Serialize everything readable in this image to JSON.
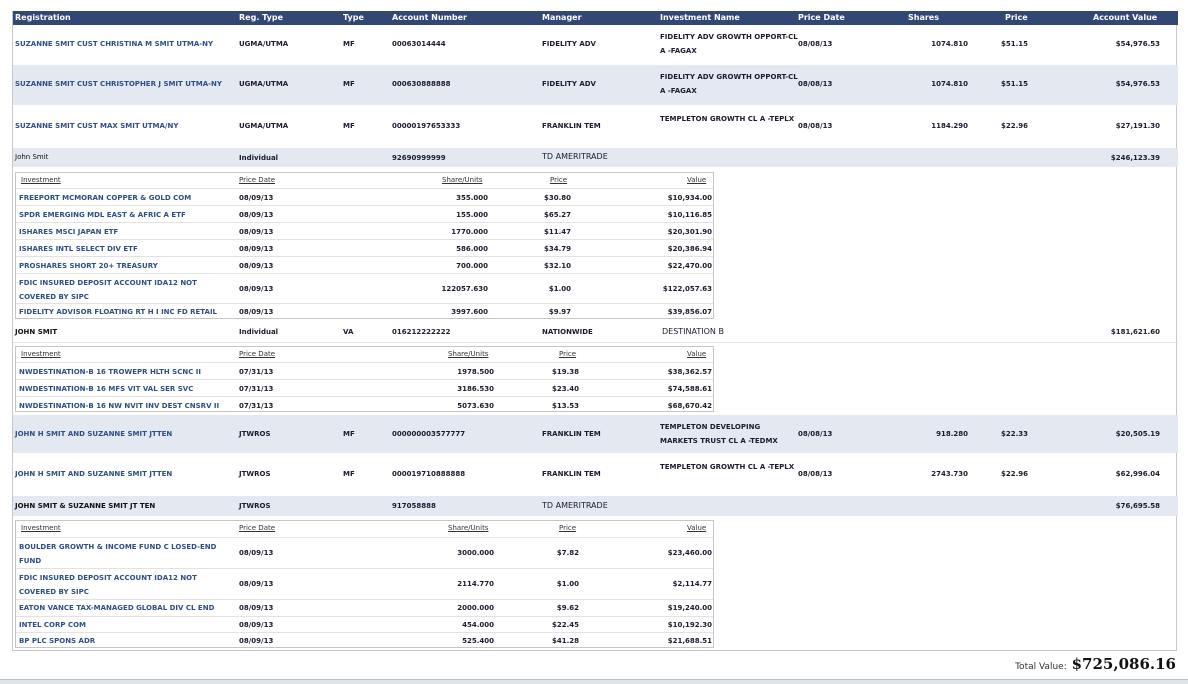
{
  "header": {
    "registration": "Registration",
    "reg_type": "Reg. Type",
    "type": "Type",
    "account_number": "Account Number",
    "manager": "Manager",
    "investment_name": "Investment Name",
    "price_date": "Price Date",
    "shares": "Shares",
    "price": "Price",
    "account_value": "Account Value"
  },
  "accounts": [
    {
      "registration": "SUZANNE SMIT CUST CHRISTINA M SMIT UTMA-NY",
      "reg_type": "UGMA/UTMA",
      "type": "MF",
      "account_number": "00063014444",
      "manager": "FIDELITY ADV",
      "investment_name": "FIDELITY ADV GROWTH OPPORT-CL A -FAGAX",
      "price_date": "08/08/13",
      "shares": "1074.810",
      "price": "$51.15",
      "account_value": "$54,976.53"
    },
    {
      "registration": "SUZANNE SMIT CUST CHRISTOPHER J SMIT UTMA-NY",
      "reg_type": "UGMA/UTMA",
      "type": "MF",
      "account_number": "000630888888",
      "manager": "FIDELITY ADV",
      "investment_name": "FIDELITY ADV GROWTH OPPORT-CL A -FAGAX",
      "price_date": "08/08/13",
      "shares": "1074.810",
      "price": "$51.15",
      "account_value": "$54,976.53"
    },
    {
      "registration": "SUZANNE SMIT CUST MAX SMIT UTMA/NY",
      "reg_type": "UGMA/UTMA",
      "type": "MF",
      "account_number": "00000197653333",
      "manager": "FRANKLIN TEM",
      "investment_name": "TEMPLETON GROWTH CL A -TEPLX",
      "price_date": "08/08/13",
      "shares": "1184.290",
      "price": "$22.96",
      "account_value": "$27,191.30"
    },
    {
      "registration": "John Smit",
      "reg_type": "Individual",
      "type": "",
      "account_number": "92690999999",
      "manager": "TD AMERITRADE",
      "investment_name": "",
      "price_date": "",
      "shares": "",
      "price": "",
      "account_value": "$246,123.39"
    },
    {
      "registration": "JOHN SMIT",
      "reg_type": "Individual",
      "type": "VA",
      "account_number": "016212222222",
      "manager": "NATIONWIDE",
      "investment_name": "DESTINATION B",
      "price_date": "",
      "shares": "",
      "price": "",
      "account_value": "$181,621.60"
    },
    {
      "registration": "JOHN H SMIT AND SUZANNE SMIT JTTEN",
      "reg_type": "JTWROS",
      "type": "MF",
      "account_number": "000000003577777",
      "manager": "FRANKLIN TEM",
      "investment_name": "TEMPLETON DEVELOPING MARKETS TRUST CL A -TEDMX",
      "price_date": "08/08/13",
      "shares": "918.280",
      "price": "$22.33",
      "account_value": "$20,505.19"
    },
    {
      "registration": "JOHN H SMIT AND SUZANNE SMIT JTTEN",
      "reg_type": "JTWROS",
      "type": "MF",
      "account_number": "000019710888888",
      "manager": "FRANKLIN TEM",
      "investment_name": "TEMPLETON GROWTH CL A -TEPLX",
      "price_date": "08/08/13",
      "shares": "2743.730",
      "price": "$22.96",
      "account_value": "$62,996.04"
    },
    {
      "registration": "JOHN SMIT & SUZANNE SMIT JT TEN",
      "reg_type": "JTWROS",
      "type": "",
      "account_number": "917058888",
      "manager": "TD AMERITRADE",
      "investment_name": "",
      "price_date": "",
      "shares": "",
      "price": "",
      "account_value": "$76,695.58"
    }
  ],
  "sub_header": {
    "investment": "Investment",
    "price_date": "Price Date",
    "shares": "Share/Units",
    "price": "Price",
    "value": "Value"
  },
  "holdings_td1": [
    {
      "name": "FREEPORT MCMORAN COPPER & GOLD COM",
      "date": "08/09/13",
      "shares": "355.000",
      "price": "$30.80",
      "value": "$10,934.00"
    },
    {
      "name": "SPDR EMERGING MDL EAST & AFRIC A ETF",
      "date": "08/09/13",
      "shares": "155.000",
      "price": "$65.27",
      "value": "$10,116.85"
    },
    {
      "name": "ISHARES MSCI JAPAN ETF",
      "date": "08/09/13",
      "shares": "1770.000",
      "price": "$11.47",
      "value": "$20,301.90"
    },
    {
      "name": "ISHARES INTL SELECT DIV ETF",
      "date": "08/09/13",
      "shares": "586.000",
      "price": "$34.79",
      "value": "$20,386.94"
    },
    {
      "name": "PROSHARES SHORT 20+ TREASURY",
      "date": "08/09/13",
      "shares": "700.000",
      "price": "$32.10",
      "value": "$22,470.00"
    },
    {
      "name": "FDIC INSURED DEPOSIT ACCOUNT IDA12 NOT COVERED BY SIPC",
      "date": "08/09/13",
      "shares": "122057.630",
      "price": "$1.00",
      "value": "$122,057.63"
    },
    {
      "name": "FIDELITY ADVISOR FLOATING RT H I INC FD RETAIL",
      "date": "08/09/13",
      "shares": "3997.600",
      "price": "$9.97",
      "value": "$39,856.07"
    }
  ],
  "holdings_nw": [
    {
      "name": "NWDESTINATION-B 16 TROWEPR HLTH SCNC II",
      "date": "07/31/13",
      "shares": "1978.500",
      "price": "$19.38",
      "value": "$38,362.57"
    },
    {
      "name": "NWDESTINATION-B 16 MFS VIT VAL SER SVC",
      "date": "07/31/13",
      "shares": "3186.530",
      "price": "$23.40",
      "value": "$74,588.61"
    },
    {
      "name": "NWDESTINATION-B 16 NW NVIT INV DEST CNSRV II",
      "date": "07/31/13",
      "shares": "5073.630",
      "price": "$13.53",
      "value": "$68,670.42"
    }
  ],
  "holdings_td2": [
    {
      "name": "BOULDER GROWTH & INCOME FUND C LOSED-END FUND",
      "date": "08/09/13",
      "shares": "3000.000",
      "price": "$7.82",
      "value": "$23,460.00"
    },
    {
      "name": "FDIC INSURED DEPOSIT ACCOUNT IDA12 NOT COVERED BY SIPC",
      "date": "08/09/13",
      "shares": "2114.770",
      "price": "$1.00",
      "value": "$2,114.77"
    },
    {
      "name": "EATON VANCE TAX-MANAGED GLOBAL DIV CL END",
      "date": "08/09/13",
      "shares": "2000.000",
      "price": "$9.62",
      "value": "$19,240.00"
    },
    {
      "name": "INTEL CORP COM",
      "date": "08/09/13",
      "shares": "454.000",
      "price": "$22.45",
      "value": "$10,192.30"
    },
    {
      "name": "BP PLC SPONS ADR",
      "date": "08/09/13",
      "shares": "525.400",
      "price": "$41.28",
      "value": "$21,688.51"
    }
  ],
  "total": {
    "label": "Total Value:",
    "value": "$725,086.16"
  },
  "colors": {
    "header_bg": "#334775",
    "row_shade": "#e3e8f1",
    "link_text": "#2e4e86"
  }
}
